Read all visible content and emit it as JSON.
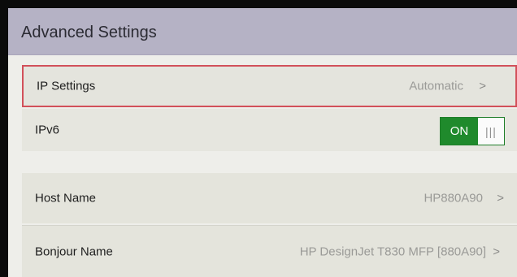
{
  "header": {
    "title": "Advanced Settings"
  },
  "settings": [
    {
      "label": "IP Settings",
      "value": "Automatic",
      "chevron": ">"
    },
    {
      "label": "IPv6",
      "toggle": {
        "state_label": "ON",
        "knob_glyph": "|||",
        "on": true
      }
    },
    {
      "label": "Host Name",
      "value": "HP880A90",
      "chevron": ">"
    },
    {
      "label": "Bonjour Name",
      "value": "HP DesignJet T830 MFP [880A90]",
      "chevron": ">"
    }
  ],
  "colors": {
    "header_bg": "#b5b2c5",
    "selected_border": "#d2505a",
    "toggle_on": "#1f8a2c"
  },
  "icons": {
    "chevron": "chevron-right-icon",
    "toggle_grip": "grip-lines-icon"
  }
}
